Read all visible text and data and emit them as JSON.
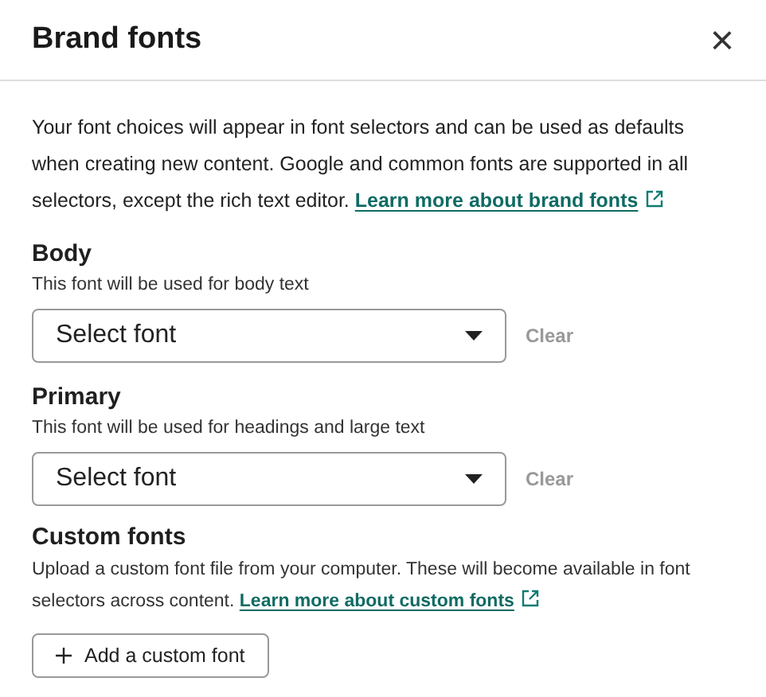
{
  "dialog": {
    "title": "Brand fonts",
    "close": "×"
  },
  "intro": {
    "text": "Your font choices will appear in font selectors and can be used as defaults when creating new content. Google and common fonts are supported in all selectors, except the rich text editor.",
    "link": "Learn more about brand fonts"
  },
  "sections": [
    {
      "kind": "select",
      "heading": "Body",
      "description": "This font will be used for body text",
      "select": {
        "value": "Select font"
      },
      "clear": "Clear"
    },
    {
      "kind": "select",
      "heading": "Primary",
      "description": "This font will be used for headings and large text",
      "select": {
        "value": "Select font"
      },
      "clear": "Clear"
    },
    {
      "kind": "custom",
      "heading": "Custom fonts",
      "description": "Upload a custom font file from your computer. These will become available in font selectors across content.",
      "link": "Learn more about custom fonts",
      "button": "Add a custom font"
    }
  ]
}
